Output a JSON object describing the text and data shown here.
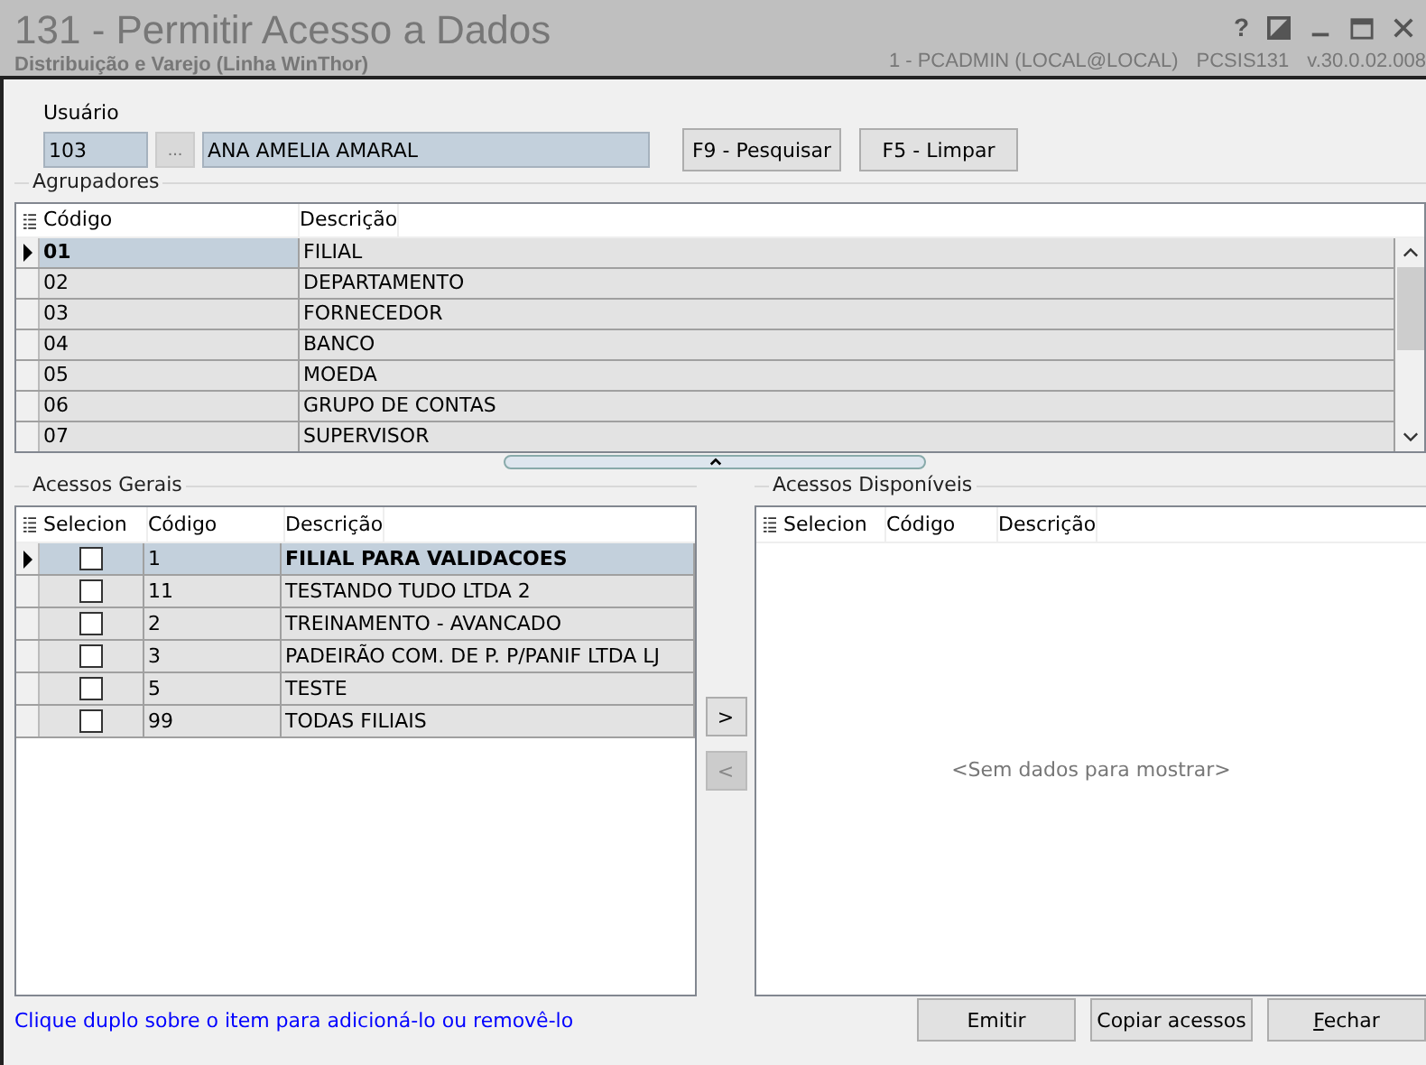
{
  "window": {
    "title": "131 - Permitir Acesso a Dados",
    "subtitle": "Distribuição e Varejo (Linha WinThor)",
    "session": "1 - PCADMIN (LOCAL@LOCAL)",
    "program": "PCSIS131",
    "version": "v.30.0.02.008",
    "help": "?"
  },
  "user": {
    "label": "Usuário",
    "code": "103",
    "browse": "...",
    "name": "ANA AMELIA AMARAL",
    "buttons": [
      "F9 - Pesquisar",
      "F5 - Limpar"
    ]
  },
  "groupers": {
    "title": "Agrupadores",
    "columns": [
      "Código",
      "Descrição"
    ],
    "rows": [
      {
        "code": "01",
        "description": "FILIAL",
        "selected": true
      },
      {
        "code": "02",
        "description": "DEPARTAMENTO",
        "selected": false
      },
      {
        "code": "03",
        "description": "FORNECEDOR",
        "selected": false
      },
      {
        "code": "04",
        "description": "BANCO",
        "selected": false
      },
      {
        "code": "05",
        "description": "MOEDA",
        "selected": false
      },
      {
        "code": "06",
        "description": "GRUPO DE CONTAS",
        "selected": false
      },
      {
        "code": "07",
        "description": "SUPERVISOR",
        "selected": false
      }
    ]
  },
  "general_access": {
    "title": "Acessos Gerais",
    "columns": [
      "Selecion",
      "Código",
      "Descrição"
    ],
    "rows": [
      {
        "checked": false,
        "code": "1",
        "description": "FILIAL PARA VALIDACOES",
        "selected": true
      },
      {
        "checked": false,
        "code": "11",
        "description": "TESTANDO TUDO LTDA 2",
        "selected": false
      },
      {
        "checked": false,
        "code": "2",
        "description": "TREINAMENTO - AVANCADO",
        "selected": false
      },
      {
        "checked": false,
        "code": "3",
        "description": "PADEIRÃO COM. DE P. P/PANIF LTDA LJ",
        "selected": false
      },
      {
        "checked": false,
        "code": "5",
        "description": "TESTE",
        "selected": false
      },
      {
        "checked": false,
        "code": "99",
        "description": "TODAS FILIAIS",
        "selected": false
      }
    ]
  },
  "move_buttons": [
    {
      "label": ">",
      "disabled": false
    },
    {
      "label": "<",
      "disabled": true
    }
  ],
  "available_access": {
    "title": "Acessos Disponíveis",
    "columns": [
      "Selecion",
      "Código",
      "Descrição"
    ],
    "empty_text": "<Sem dados para mostrar>"
  },
  "hint": "Clique duplo sobre o item para adicioná-lo ou removê-lo",
  "footer_buttons": [
    "Emitir",
    "Copiar acessos",
    "Fechar"
  ]
}
